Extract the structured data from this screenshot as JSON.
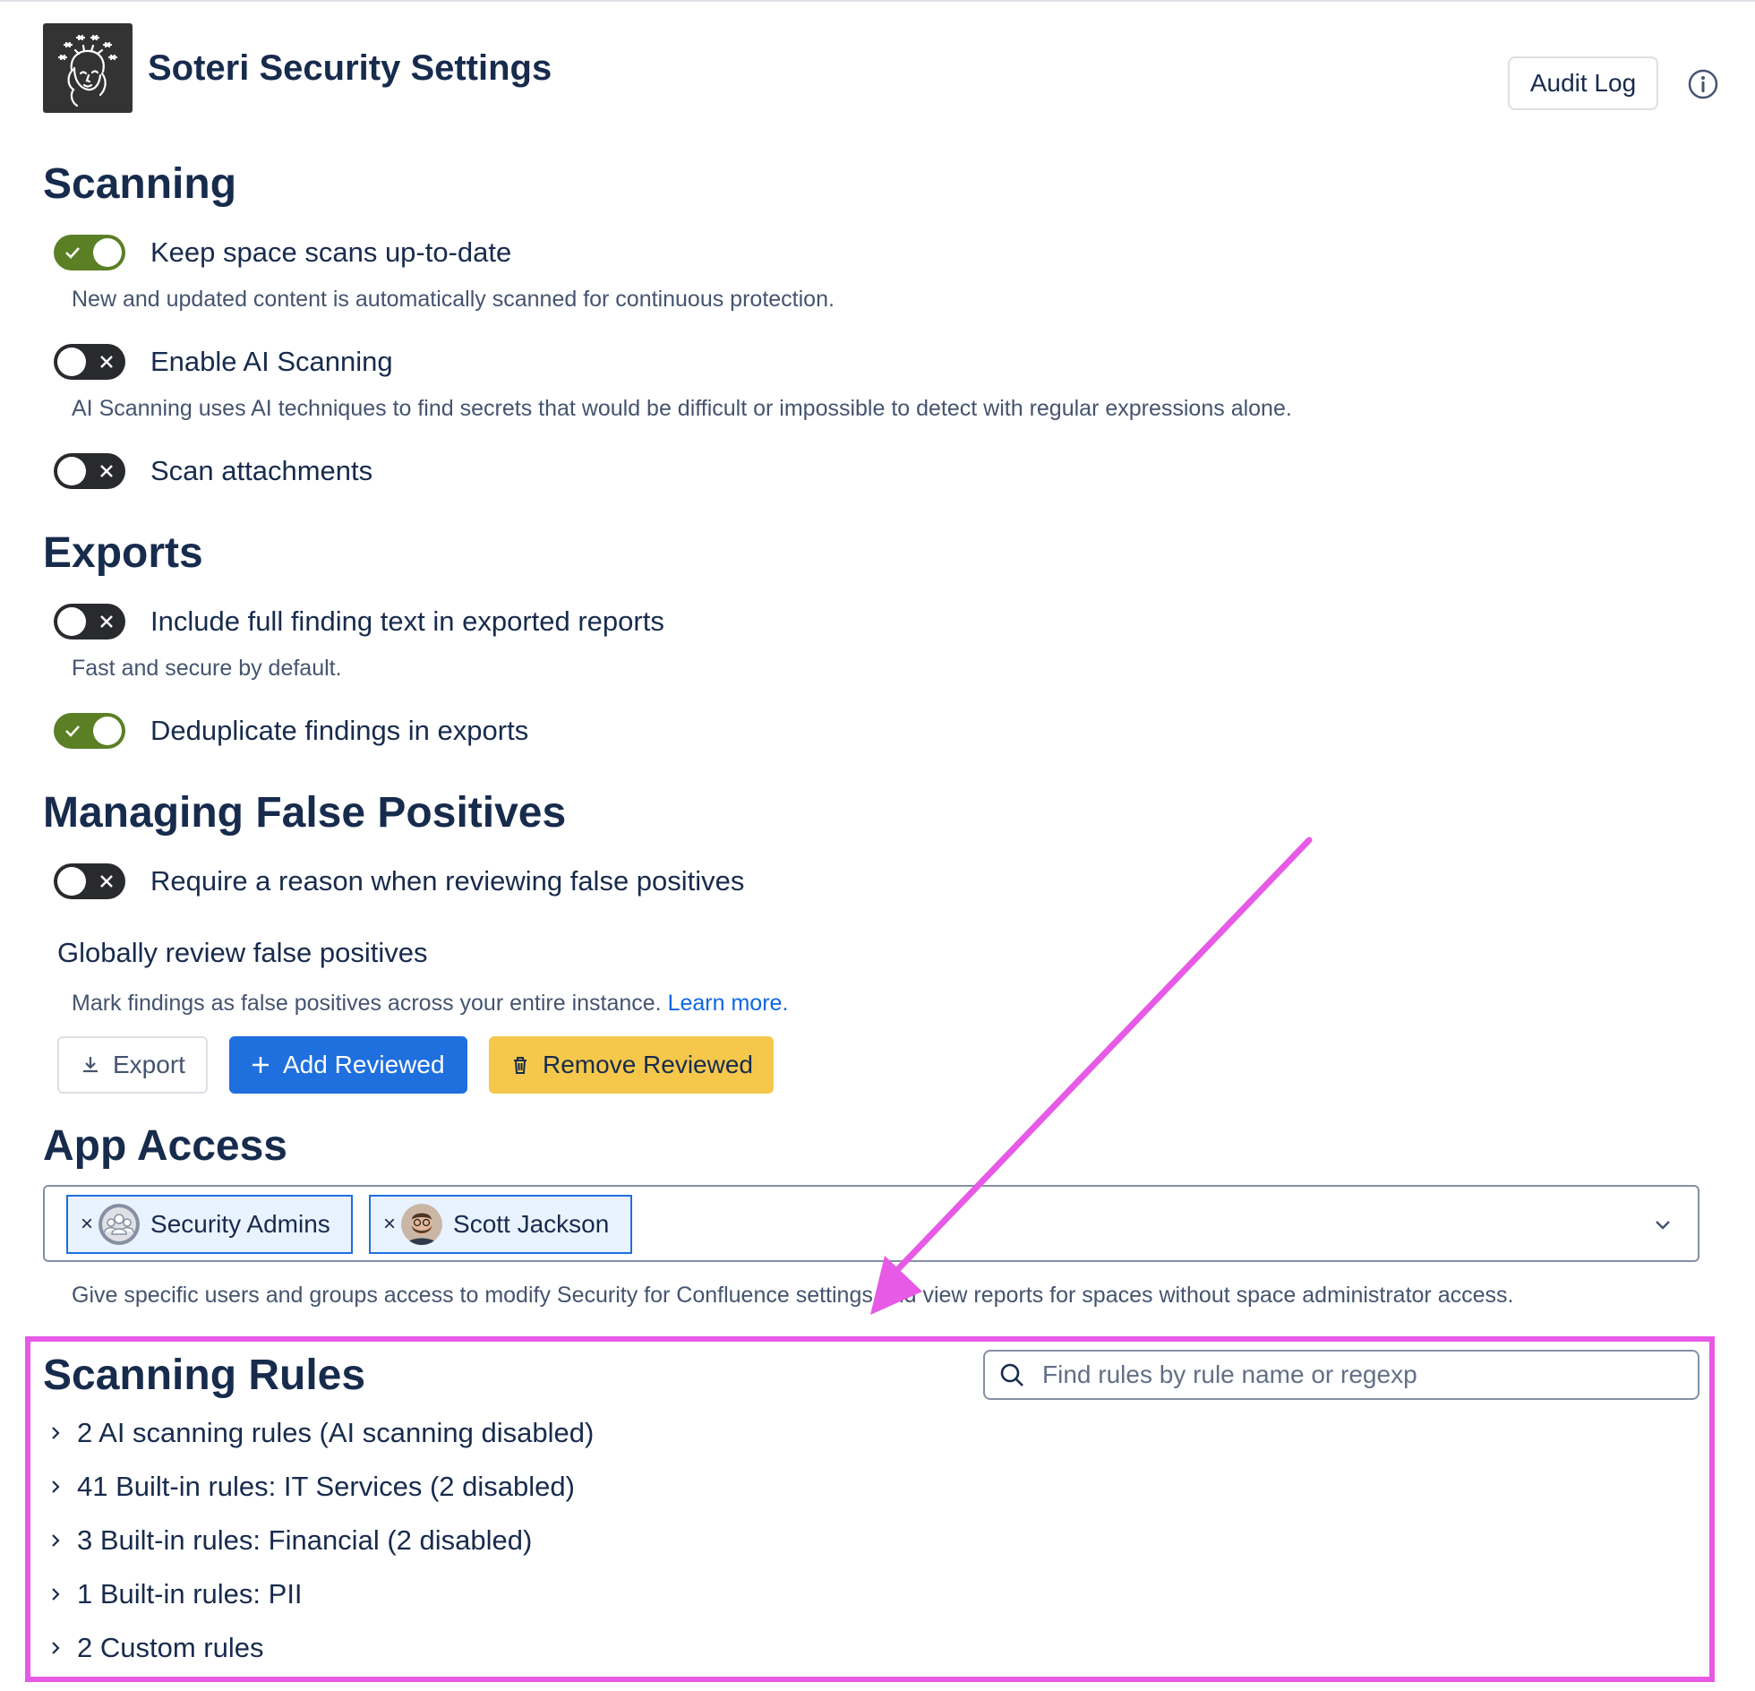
{
  "header": {
    "title": "Soteri Security Settings",
    "audit_log_label": "Audit Log",
    "logo_icon": "soteri-logo-icon",
    "info_icon": "info-icon"
  },
  "scanning": {
    "heading": "Scanning",
    "items": [
      {
        "label": "Keep space scans up-to-date",
        "enabled": true,
        "description": "New and updated content is automatically scanned for continuous protection."
      },
      {
        "label": "Enable AI Scanning",
        "enabled": false,
        "description": "AI Scanning uses AI techniques to find secrets that would be difficult or impossible to detect with regular expressions alone."
      },
      {
        "label": "Scan attachments",
        "enabled": false
      }
    ]
  },
  "exports": {
    "heading": "Exports",
    "items": [
      {
        "label": "Include full finding text in exported reports",
        "enabled": false,
        "description": "Fast and secure by default."
      },
      {
        "label": "Deduplicate findings in exports",
        "enabled": true
      }
    ]
  },
  "false_positives": {
    "heading": "Managing False Positives",
    "require_reason": {
      "label": "Require a reason when reviewing false positives",
      "enabled": false
    },
    "global_review": {
      "title": "Globally review false positives",
      "description": "Mark findings as false positives across your entire instance.",
      "learn_more": "Learn more."
    },
    "buttons": {
      "export": "Export",
      "add_reviewed": "Add Reviewed",
      "remove_reviewed": "Remove Reviewed"
    }
  },
  "app_access": {
    "heading": "App Access",
    "chips": [
      {
        "label": "Security Admins",
        "type": "group"
      },
      {
        "label": "Scott Jackson",
        "type": "user"
      }
    ],
    "description": "Give specific users and groups access to modify Security for Confluence settings and view reports for spaces without space administrator access."
  },
  "scanning_rules": {
    "heading": "Scanning Rules",
    "search_placeholder": "Find rules by rule name or regexp",
    "groups": [
      "2 AI scanning rules (AI scanning disabled)",
      "41 Built-in rules: IT Services (2 disabled)",
      "3 Built-in rules: Financial (2 disabled)",
      "1 Built-in rules: PII",
      "2 Custom rules"
    ]
  },
  "colors": {
    "toggle_on": "#5b7f24",
    "toggle_off": "#292a2e",
    "primary_button": "#1f6fde",
    "warning_button": "#f5c84c",
    "link": "#0c66e4",
    "annotation": "#e65ae6"
  }
}
